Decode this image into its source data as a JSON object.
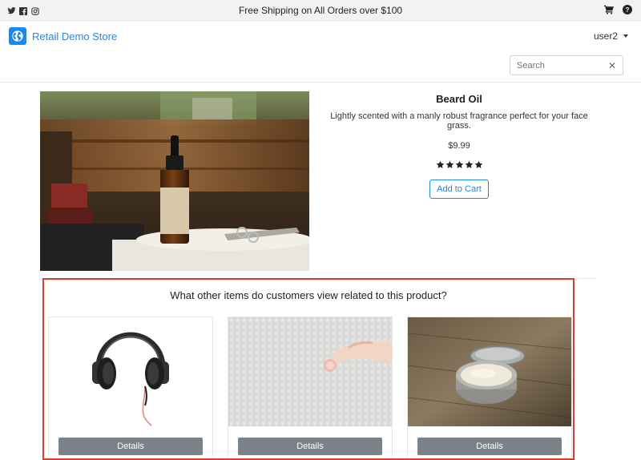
{
  "topbar": {
    "social_icons": [
      "twitter-icon",
      "facebook-icon",
      "instagram-icon"
    ],
    "promo_text": "Free Shipping on All Orders over $100",
    "right_icons": [
      "cart-icon",
      "help-icon"
    ]
  },
  "header": {
    "brand_name": "Retail Demo Store",
    "user_label": "user2",
    "search_placeholder": "Search",
    "search_clear": "✕"
  },
  "product": {
    "title": "Beard Oil",
    "description": "Lightly scented with a manly robust fragrance perfect for your face grass.",
    "price": "$9.99",
    "rating": 5,
    "add_to_cart_label": "Add to Cart"
  },
  "related": {
    "title": "What other items do customers view related to this product?",
    "items": [
      {
        "image": "headphones",
        "button_label": "Details"
      },
      {
        "image": "hand-with-lip-balm",
        "button_label": "Details"
      },
      {
        "image": "tin-of-balm",
        "button_label": "Details"
      }
    ]
  },
  "colors": {
    "brand": "#1a87f5",
    "highlight_border": "#e03c2b",
    "details_button": "#7b8289"
  }
}
